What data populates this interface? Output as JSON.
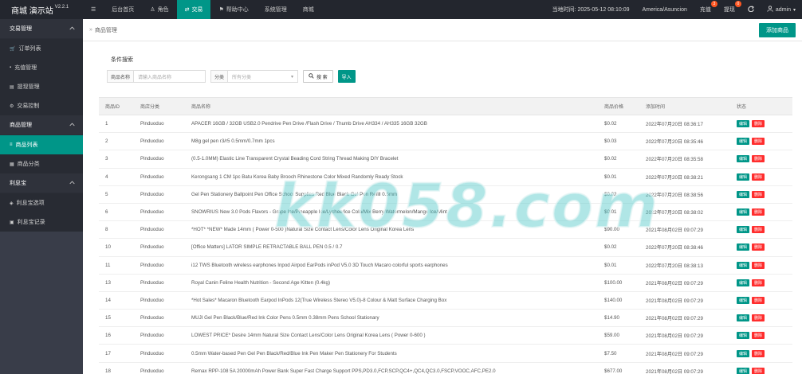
{
  "brand": {
    "name": "商城 演示站",
    "version": "V2.2.1"
  },
  "topnav": [
    {
      "label": "",
      "icon": "menu-icon",
      "name": "menu-toggle"
    },
    {
      "label": "后台首页",
      "name": "nav-home"
    },
    {
      "label": "角色",
      "icon": "user-icon",
      "name": "nav-role"
    },
    {
      "label": "交易",
      "icon": "exchange-icon",
      "name": "nav-trade",
      "active": true
    },
    {
      "label": "帮助中心",
      "icon": "flag-icon",
      "name": "nav-help"
    },
    {
      "label": "系统管理",
      "name": "nav-system"
    },
    {
      "label": "商城",
      "name": "nav-mall"
    }
  ],
  "topright": {
    "time_label": "当地时间: 2025-05-12 08:10:09",
    "timezone": "America/Asuncion",
    "recharge": "充值",
    "recharge_badge": "3",
    "withdraw": "提现",
    "withdraw_badge": "0",
    "user": "admin"
  },
  "sidebar": {
    "groups": [
      {
        "label": "交易管理",
        "items": [
          {
            "label": "订单列表",
            "icon": "cart-icon"
          },
          {
            "label": "充值管理",
            "icon": "wallet-icon"
          },
          {
            "label": "提现管理",
            "icon": "withdraw-icon"
          },
          {
            "label": "交易控制",
            "icon": "control-icon"
          }
        ]
      },
      {
        "label": "商品管理",
        "items": [
          {
            "label": "商品列表",
            "icon": "list-icon",
            "active": true
          },
          {
            "label": "商品分类",
            "icon": "category-icon"
          }
        ]
      },
      {
        "label": "利息宝",
        "items": [
          {
            "label": "利息宝选项",
            "icon": "option-icon"
          },
          {
            "label": "利息宝记录",
            "icon": "record-icon"
          }
        ]
      }
    ]
  },
  "breadcrumb": "商品管理",
  "add_button": "添加商品",
  "search": {
    "title": "条件搜索",
    "name_label": "商品名称",
    "name_placeholder": "请输入商品名称",
    "cat_label": "分类",
    "cat_value": "所有分类",
    "search_button": "搜 索",
    "import_button": "导入"
  },
  "table": {
    "headers": [
      "商品ID",
      "商店分类",
      "商品名称",
      "商品价格",
      "添加时间",
      "状态"
    ],
    "edit_label": "编辑",
    "delete_label": "删除",
    "rows": [
      [
        "1",
        "Pinduoduo",
        "APACER 16GB / 32GB USB2.0 Pendrive Pen Drive /Flash Drive / Thumb Drive AH334 / AH335 16GB 32GB",
        "$0.02",
        "2022年07月20日 08:36:17"
      ],
      [
        "2",
        "Pinduoduo",
        "M8g gel pen r3/r5 0.5mm/0.7mm 1pcs",
        "$0.03",
        "2022年07月20日 08:35:46"
      ],
      [
        "3",
        "Pinduoduo",
        "(0.5-1.0MM) Elastic Line Transparent Crystal Beading Cord String Thread Making DIY Bracelet",
        "$0.02",
        "2022年07月20日 08:35:58"
      ],
      [
        "4",
        "Pinduoduo",
        "Kerongsang 1 CM 1pc Batu Korea Baby Brooch Rhinestone Color Mixed Randomly Ready Stock",
        "$0.01",
        "2022年07月20日 08:38:21"
      ],
      [
        "5",
        "Pinduoduo",
        "Gel Pen Stationery Ballpoint Pen Office School Supplies Red Blue Black Gel Pen Refill 0.5mm",
        "$0.02",
        "2022年07月20日 08:38:56"
      ],
      [
        "6",
        "Pinduoduo",
        "SNOWRIUS New 3.0 Pods Flavors - Grape Ice/Pineapple Ice/Lychee/Ice Cola/Mix Berry/Watermelon/Mango Ice/Mint",
        "$0.01",
        "2022年07月20日 08:38:02"
      ],
      [
        "8",
        "Pinduoduo",
        "*HOT* *NEW* Made 14mm ( Power 0-500 )Natural Size Contact Lens/Color Lens Original Korea Lens",
        "$90.00",
        "2021年08月02日 09:07:29"
      ],
      [
        "10",
        "Pinduoduo",
        "[Office Matters] LATOR SIMPLE RETRACTABLE BALL PEN 0.5 / 0.7",
        "$0.02",
        "2022年07月20日 08:38:46"
      ],
      [
        "11",
        "Pinduoduo",
        "i12 TWS Bluetooth wireless earphones Inpod Airpod EarPods inPod V5.0 3D Touch Macaro colorful sports earphones",
        "$0.01",
        "2022年07月20日 08:38:13"
      ],
      [
        "13",
        "Pinduoduo",
        "Royal Canin Feline Health Nutrition - Second Age Kitten (0.4kg)",
        "$100.00",
        "2021年08月02日 09:07:29"
      ],
      [
        "14",
        "Pinduoduo",
        "*Hot Sales* Macaron Bluetooth Earpod InPods 12(True Wireless Stereo V5.0)-8 Colour & Matt Surface Charging Box",
        "$140.00",
        "2021年08月02日 09:07:29"
      ],
      [
        "15",
        "Pinduoduo",
        "MUJI Gel Pen Black/Blue/Red Ink Color Pens 0.5mm 0.38mm Pens School Stationary",
        "$14.90",
        "2021年08月02日 09:07:29"
      ],
      [
        "16",
        "Pinduoduo",
        "LOWEST PRICE* Desire 14mm Natural Size Contact Lens/Color Lens Original Korea Lens ( Power 0-600 )",
        "$59.00",
        "2021年08月02日 09:07:29"
      ],
      [
        "17",
        "Pinduoduo",
        "0.5mm Water-based Pen Gel Pen Black/Red/Blue Ink Pen Maker Pen Stationery For Students",
        "$7.50",
        "2021年08月02日 09:07:29"
      ],
      [
        "18",
        "Pinduoduo",
        "Remax RPP-108 5A 20000mAh Power Bank Super Fast Charge Support PPS,PD3.0,FCP,SCP,QC4+,QC4,QC3.0,FSCP,VOOC,AFC,PE2.0",
        "$677.00",
        "2021年08月02日 09:07:29"
      ]
    ]
  },
  "watermark": "kk058.com"
}
